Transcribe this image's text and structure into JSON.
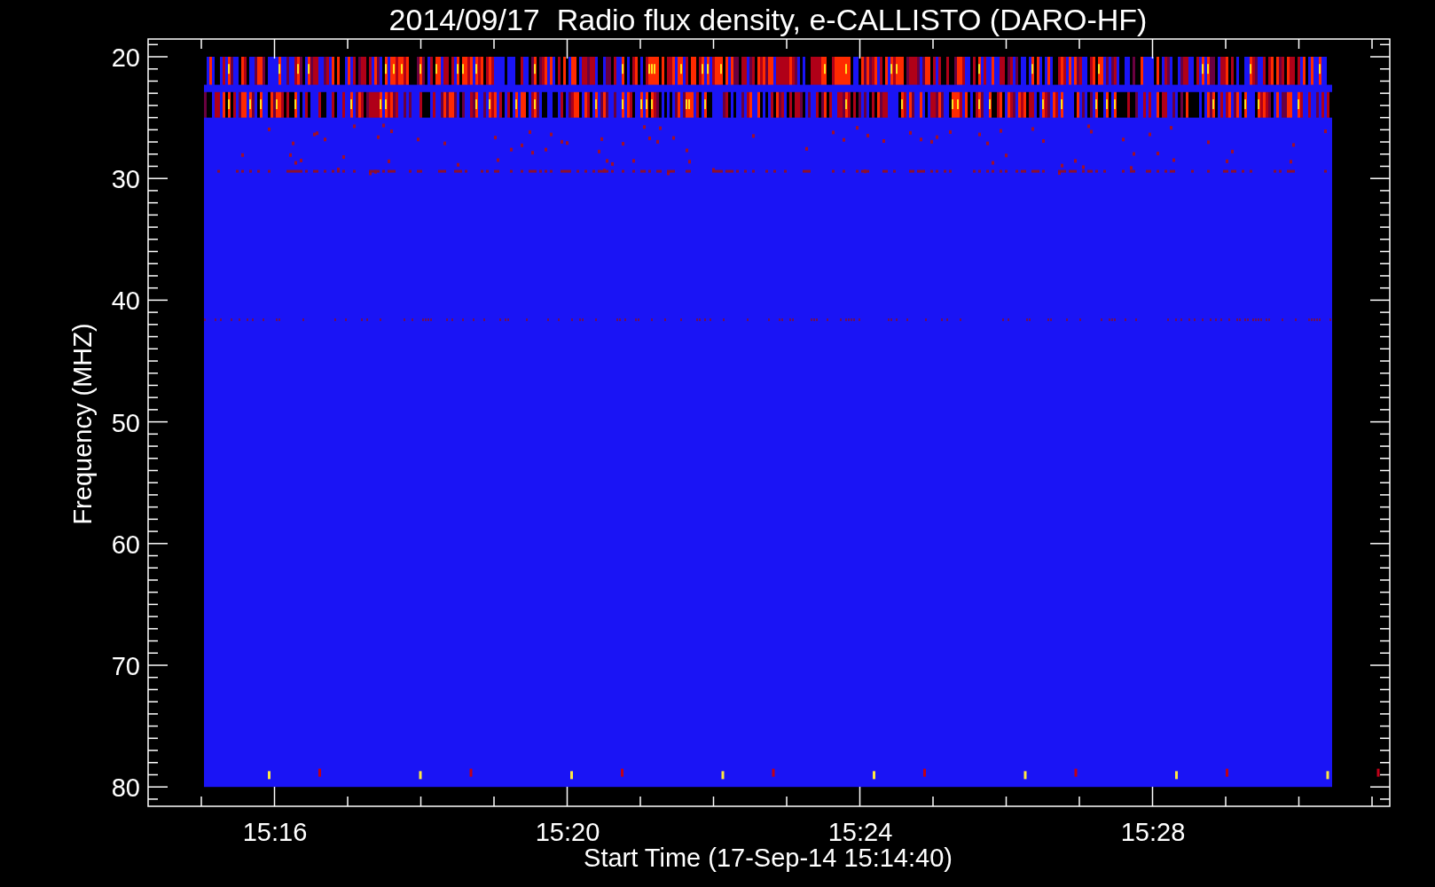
{
  "title": "2014/09/17  Radio flux density, e-CALLISTO (DARO-HF)",
  "y_axis": {
    "label": "Frequency (MHZ)",
    "ticks": [
      "20",
      "30",
      "40",
      "50",
      "60",
      "70",
      "80"
    ]
  },
  "x_axis": {
    "label": "Start Time (17-Sep-14 15:14:40)",
    "ticks": [
      "15:16",
      "15:20",
      "15:24",
      "15:28"
    ]
  }
}
